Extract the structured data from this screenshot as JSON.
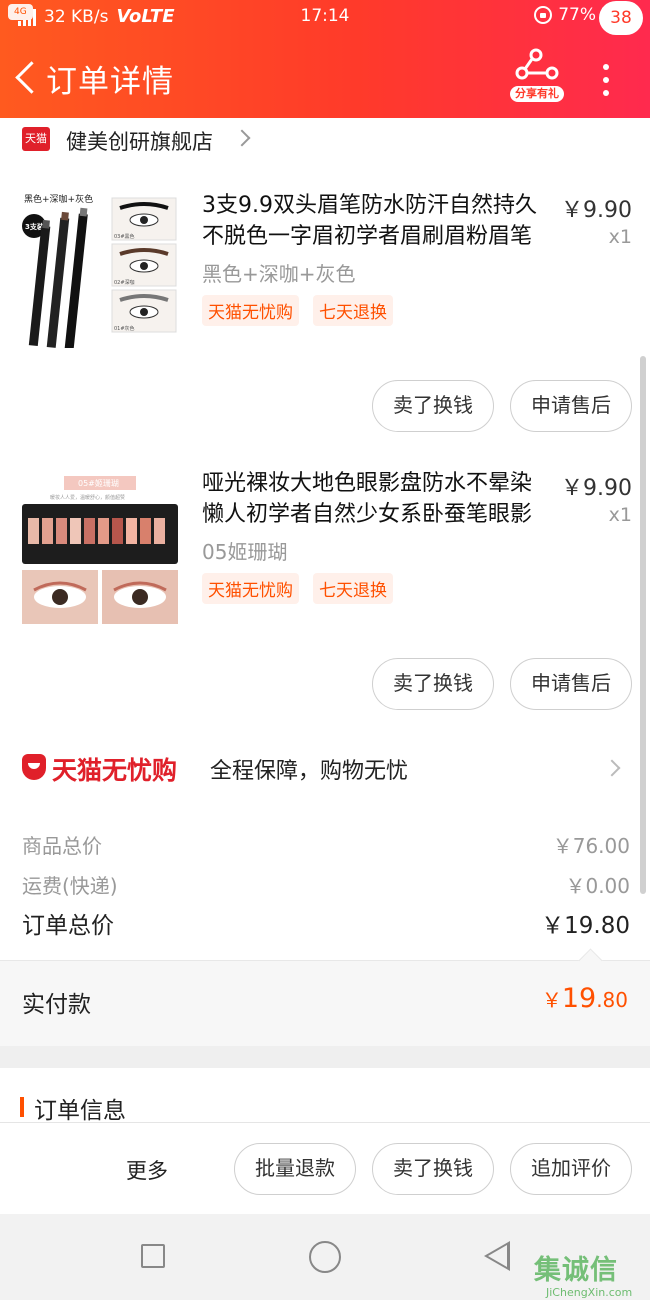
{
  "status_bar": {
    "network_tag": "4G",
    "speed": "32 KB/s",
    "volte": "VoLTE",
    "time": "17:14",
    "battery": "77%",
    "battery_level": 0.77
  },
  "nav": {
    "title": "订单详情",
    "share_label": "分享有礼",
    "badge_count": "38"
  },
  "shop": {
    "brand_badge": "天猫",
    "name": "健美创研旗舰店"
  },
  "items": [
    {
      "title": "3支9.9双头眉笔防水防汗自然持久不脱色一字眉初学者眉刷眉粉眉笔",
      "price": "￥9.90",
      "qty": "x1",
      "sku": "黑色+深咖+灰色",
      "tags": [
        "天猫无忧购",
        "七天退换"
      ],
      "buttons": [
        "卖了换钱",
        "申请售后"
      ],
      "thumb_text": {
        "header": "黑色+深咖+灰色",
        "badge": "3支装",
        "labels": [
          "03#黑色",
          "02#深咖",
          "01#灰色"
        ]
      }
    },
    {
      "title": "哑光裸妆大地色眼影盘防水不晕染懒人初学者自然少女系卧蚕笔眼影",
      "price": "￥9.90",
      "qty": "x1",
      "sku": "05姬珊瑚",
      "tags": [
        "天猫无忧购",
        "七天退换"
      ],
      "buttons": [
        "卖了换钱",
        "申请售后"
      ],
      "thumb_text": {
        "header": "05#姬珊瑚",
        "caption": "暖妆人人爱，温暖舒心，颜值超赞"
      }
    }
  ],
  "guarantee": {
    "brand": "天猫无忧购",
    "text": "全程保障，购物无忧"
  },
  "summary": {
    "goods_total_label": "商品总价",
    "goods_total_value": "￥76.00",
    "shipping_label": "运费(快递)",
    "shipping_value": "￥0.00",
    "order_total_label": "订单总价",
    "order_total_value": "￥19.80"
  },
  "paid": {
    "label": "实付款",
    "currency": "￥",
    "integer": "19",
    "decimal": ".80"
  },
  "order_info": {
    "title": "订单信息"
  },
  "action_bar": {
    "more": "更多",
    "buttons": [
      "批量退款",
      "卖了换钱",
      "追加评价"
    ]
  },
  "watermark": {
    "zh": "集诚信",
    "en": "JiChengXin.com"
  },
  "colors": {
    "accent": "#ff5000",
    "tmall_red": "#e0202a",
    "header_start": "#ff5a1f",
    "header_end": "#ff2a4e"
  }
}
